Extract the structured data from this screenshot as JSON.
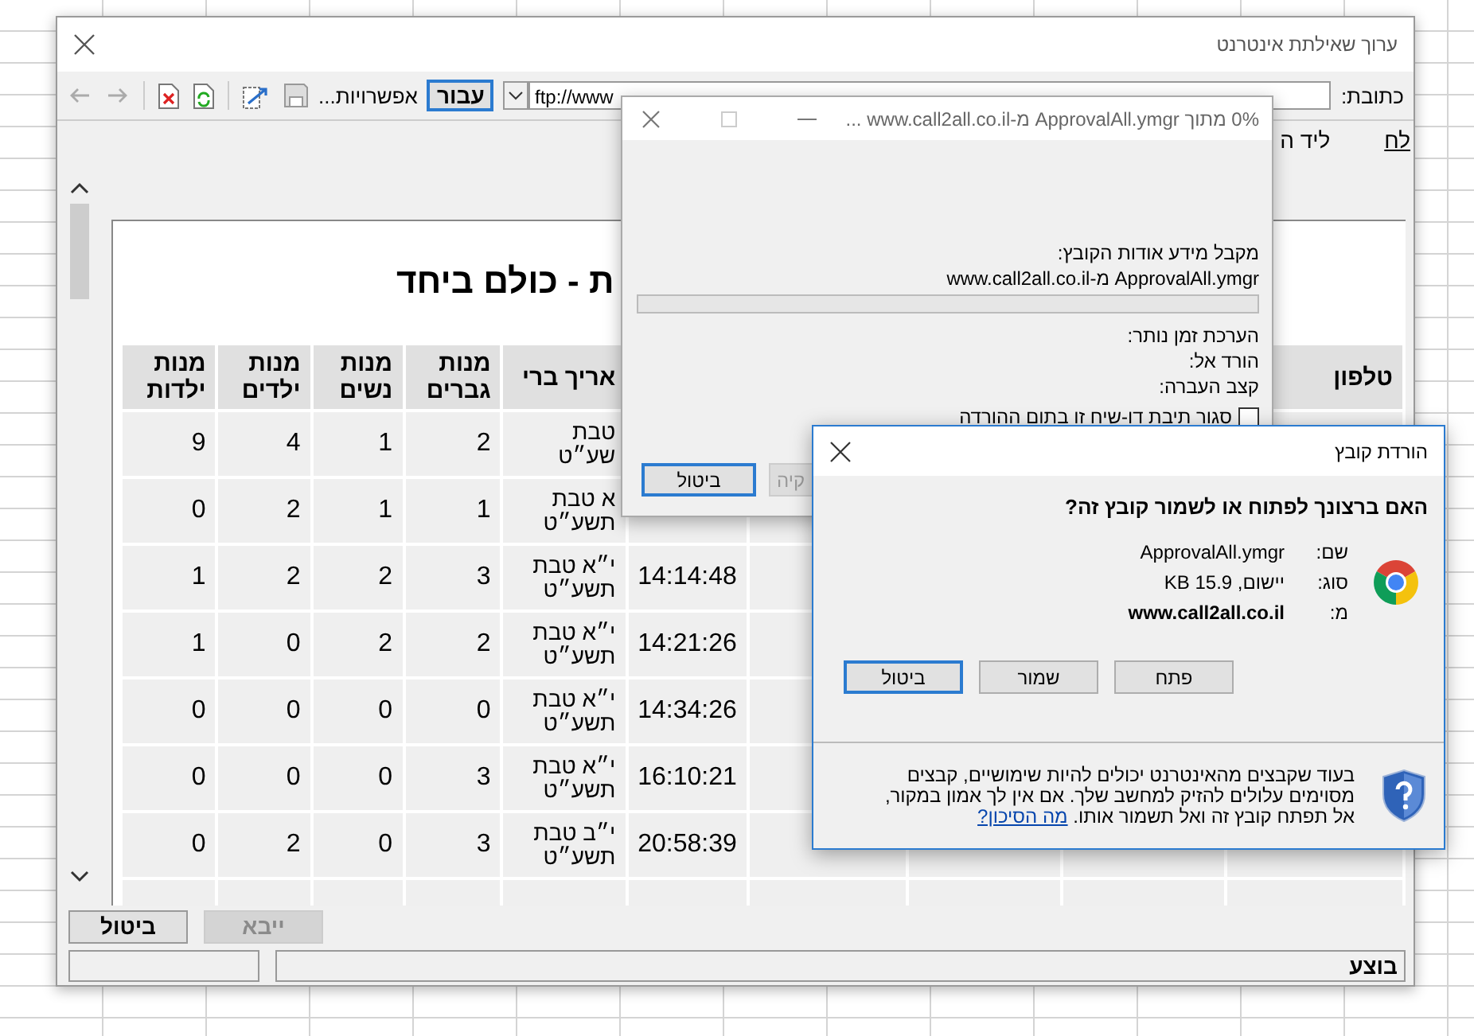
{
  "window": {
    "title": "ערוך שאילתת אינטרנט"
  },
  "toolbar": {
    "address_label": "כתובת:",
    "address": "ftp://www",
    "go_button": "עבור",
    "options_button": "אפשרויות..."
  },
  "hint": [
    "לח",
    "ליד ה"
  ],
  "page": {
    "title": "ת - כולם ביחד",
    "columns": [
      "טלפון",
      "",
      "",
      "",
      "",
      "אריך ברי",
      "מנות גברים",
      "מנות נשים",
      "מנות ילדים",
      "מנות ילדות"
    ],
    "rows": [
      {
        "date": "טבת שע״ט",
        "men": "2",
        "women": "1",
        "boys": "4",
        "girls": "9"
      },
      {
        "date": "א טבת תשע״ט",
        "men": "1",
        "women": "1",
        "boys": "2",
        "girls": "0"
      },
      {
        "time": "14:14:48",
        "date": "י״א טבת תשע״ט",
        "men": "3",
        "women": "2",
        "boys": "2",
        "girls": "1"
      },
      {
        "time": "14:21:26",
        "date": "י״א טבת תשע״ט",
        "men": "2",
        "women": "2",
        "boys": "0",
        "girls": "1"
      },
      {
        "time": "14:34:26",
        "date": "י״א טבת תשע״ט",
        "men": "0",
        "women": "0",
        "boys": "0",
        "girls": "0"
      },
      {
        "time": "16:10:21",
        "date": "י״א טבת תשע״ט",
        "men": "3",
        "women": "0",
        "boys": "0",
        "girls": "0"
      },
      {
        "time": "20:58:39",
        "date": "י״ב טבת תשע״ט",
        "men": "3",
        "women": "0",
        "boys": "2",
        "girls": "0"
      }
    ]
  },
  "buttons": [
    {
      "label": "ייבא",
      "disabled": true
    },
    {
      "label": "ביטול",
      "disabled": false
    }
  ],
  "status_bar": {
    "text": "בוצע"
  },
  "progress_dialog": {
    "title": "0% מתוך ApprovalAll.ymgr מ-www.call2all.co.il ...",
    "status": "מקבל מידע אודות הקובץ:",
    "file": "ApprovalAll.ymgr מ-www.call2all.co.il",
    "level": 0,
    "fields": [
      "הערכת זמן נותר:",
      "הורד אל:",
      "קצב העברה:"
    ],
    "close_when_done": {
      "label": "סגור תיבת דו-שיח זו בתום ההורדה",
      "checked": false
    },
    "buttons": [
      {
        "label": "קיה",
        "disabled": true
      },
      {
        "label": "ביטול",
        "disabled": false
      }
    ]
  },
  "download_dialog": {
    "title": "הורדת קובץ",
    "question": "האם ברצונך לפתוח או לשמור קובץ זה?",
    "info": [
      {
        "label": "שם:",
        "value": "ApprovalAll.ymgr",
        "bold": false
      },
      {
        "label": "סוג:",
        "value": "יישום, 15.9 KB",
        "bold": false
      },
      {
        "label": "מ:",
        "value": "www.call2all.co.il",
        "bold": true
      }
    ],
    "buttons": [
      "פתח",
      "שמור",
      "ביטול"
    ],
    "warning": "בעוד שקבצים מהאינטרנט יכולים להיות שימושיים, קבצים מסוימים עלולים להזיק למחשב שלך. אם אין לך אמון במקור, אל תפתח קובץ זה ואל תשמור אותו.",
    "risk_link": "מה הסיכון?"
  }
}
